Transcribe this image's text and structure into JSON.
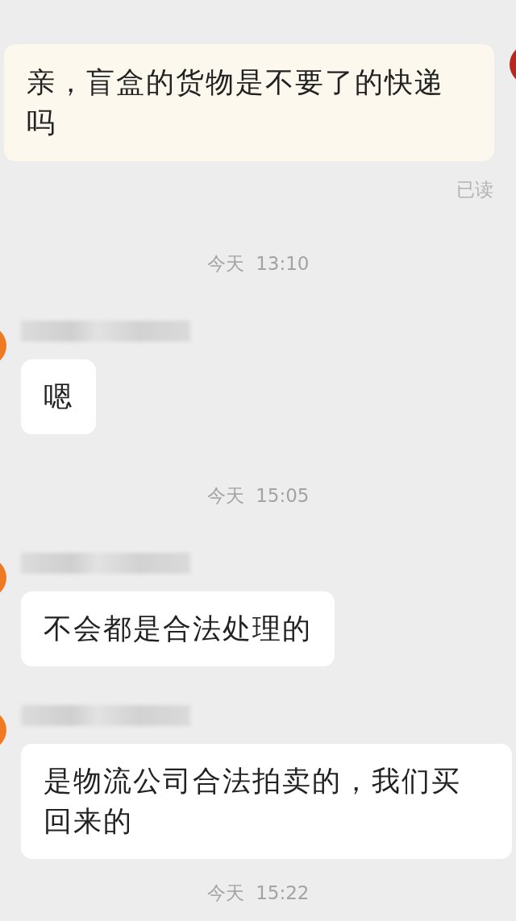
{
  "messages": [
    {
      "kind": "outgoing",
      "text": "亲，盲盒的货物是不要了的快递吗",
      "status": "已读"
    },
    {
      "kind": "time",
      "text": "今天  13:10"
    },
    {
      "kind": "incoming",
      "text": "嗯"
    },
    {
      "kind": "time",
      "text": "今天  15:05"
    },
    {
      "kind": "incoming",
      "text": "不会都是合法处理的"
    },
    {
      "kind": "incoming",
      "text": "是物流公司合法拍卖的，我们买回来的"
    },
    {
      "kind": "time",
      "text": "今天  15:22"
    }
  ]
}
